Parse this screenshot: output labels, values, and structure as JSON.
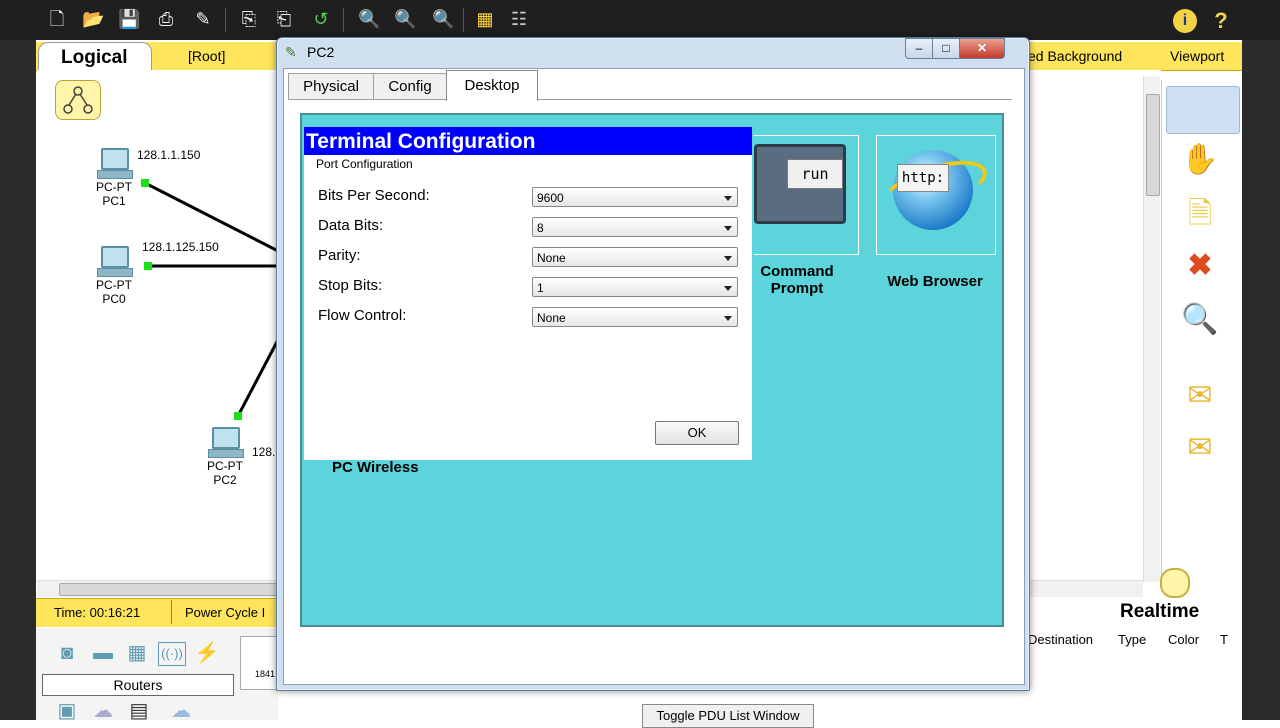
{
  "workspace": {
    "logical_tab": "Logical",
    "root": "[Root]",
    "background_partial": "ed Background",
    "viewport": "Viewport"
  },
  "devices": [
    {
      "type": "PC-PT",
      "name": "PC1",
      "ip": "128.1.1.150"
    },
    {
      "type": "PC-PT",
      "name": "PC0",
      "ip": "128.1.125.150"
    },
    {
      "type": "PC-PT",
      "name": "PC2",
      "ip_partial": "128."
    }
  ],
  "status_bar": {
    "time": "Time: 00:16:21",
    "power_cycle": "Power Cycle I"
  },
  "realtime": {
    "label": "Realtime",
    "pdu_columns": [
      "Destination",
      "Type",
      "Color",
      "T"
    ]
  },
  "device_panel": {
    "category_label": "Routers",
    "device_partial": "1841",
    "toggle_pdu": "Toggle PDU List Window"
  },
  "pc_window": {
    "title": "PC2",
    "tabs": [
      "Physical",
      "Config",
      "Desktop"
    ],
    "active_tab": "Desktop",
    "apps": {
      "command_prompt": "Command Prompt",
      "command_prompt_line1": "Command",
      "command_prompt_line2": "Prompt",
      "run_text": "run",
      "web_browser": "Web Browser",
      "http_text": "http:",
      "pc_wireless": "PC Wireless"
    }
  },
  "terminal_dialog": {
    "title": "Terminal Configuration",
    "section": "Port Configuration",
    "fields": [
      {
        "label": "Bits Per Second:",
        "value": "9600"
      },
      {
        "label": "Data Bits:",
        "value": "8"
      },
      {
        "label": "Parity:",
        "value": "None"
      },
      {
        "label": "Stop Bits:",
        "value": "1"
      },
      {
        "label": "Flow Control:",
        "value": "None"
      }
    ],
    "ok_label": "OK"
  },
  "colors": {
    "toolbar": "#1f1f1f",
    "workspace_yellow": "#ffe55c",
    "desktop_cyan": "#5cd4db",
    "dialog_title_blue": "#0000ff",
    "link_green": "#18e018"
  }
}
